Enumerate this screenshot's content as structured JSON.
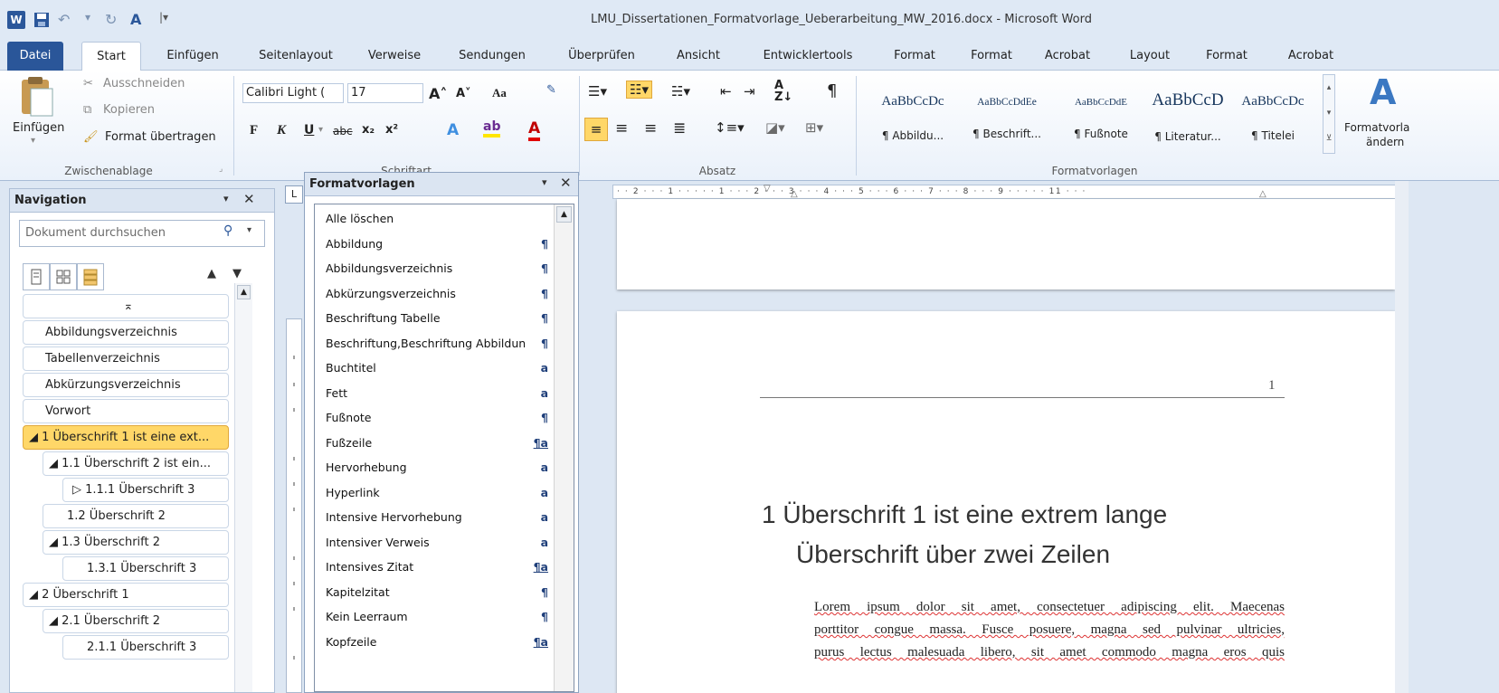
{
  "window": {
    "title": "LMU_Dissertationen_Formatvorlage_Ueberarbeitung_MW_2016.docx - Microsoft Word"
  },
  "tabs": [
    "Datei",
    "Start",
    "Einfügen",
    "Seitenlayout",
    "Verweise",
    "Sendungen",
    "Überprüfen",
    "Ansicht",
    "Entwicklertools",
    "Format",
    "Format",
    "Acrobat",
    "Layout",
    "Format",
    "Acrobat"
  ],
  "clipboard": {
    "paste_label": "Einfügen",
    "cut_label": "Ausschneiden",
    "copy_label": "Kopieren",
    "format_painter_label": "Format übertragen",
    "group_label": "Zwischenablage"
  },
  "font": {
    "name": "Calibri Light (",
    "size": "17",
    "bold": "F",
    "italic": "K",
    "underline": "U",
    "strikethrough": "abc",
    "subscript": "x₂",
    "superscript": "x²",
    "case": "Aa",
    "group_label": "Schriftart"
  },
  "paragraph": {
    "group_label": "Absatz",
    "pilcrow": "¶"
  },
  "styles_gallery": {
    "group_label": "Formatvorlagen",
    "change_label_line1": "Formatvorla",
    "change_label_line2": "ändern",
    "items": [
      {
        "sample": "AaBbCcDc",
        "name": "¶ Abbildu..."
      },
      {
        "sample": "AaBbCcDdEe",
        "name": "¶ Beschrift..."
      },
      {
        "sample": "AaBbCcDdE",
        "name": "¶ Fußnote"
      },
      {
        "sample": "AaBbCcD",
        "name": "¶ Literatur..."
      },
      {
        "sample": "AaBbCcDc",
        "name": "¶ Titelei"
      }
    ]
  },
  "navigation": {
    "title": "Navigation",
    "search_placeholder": "Dokument durchsuchen",
    "items": [
      {
        "label": "⌅",
        "level": 0
      },
      {
        "label": "Abbildungsverzeichnis",
        "level": 0
      },
      {
        "label": "Tabellenverzeichnis",
        "level": 0
      },
      {
        "label": "Abkürzungsverzeichnis",
        "level": 0
      },
      {
        "label": "Vorwort",
        "level": 0
      },
      {
        "label": "◢ 1 Überschrift 1 ist eine ext...",
        "level": 0
      },
      {
        "label": "◢ 1.1 Überschrift 2 ist ein...",
        "level": 1
      },
      {
        "label": "▷ 1.1.1 Überschrift 3",
        "level": 2
      },
      {
        "label": "1.2 Überschrift 2",
        "level": 1
      },
      {
        "label": "◢ 1.3 Überschrift 2",
        "level": 1
      },
      {
        "label": "1.3.1 Überschrift 3",
        "level": 2
      },
      {
        "label": "◢ 2 Überschrift 1",
        "level": 0
      },
      {
        "label": "◢ 2.1 Überschrift 2",
        "level": 1
      },
      {
        "label": "2.1.1 Überschrift 3",
        "level": 2
      }
    ],
    "selected_index": 5
  },
  "styles_pane": {
    "title": "Formatvorlagen",
    "items": [
      {
        "name": "Alle löschen",
        "mark": ""
      },
      {
        "name": "Abbildung",
        "mark": "¶"
      },
      {
        "name": "Abbildungsverzeichnis",
        "mark": "¶"
      },
      {
        "name": "Abkürzungsverzeichnis",
        "mark": "¶"
      },
      {
        "name": "Beschriftung Tabelle",
        "mark": "¶"
      },
      {
        "name": "Beschriftung,Beschriftung Abbildung",
        "mark": "¶"
      },
      {
        "name": "Buchtitel",
        "mark": "a"
      },
      {
        "name": "Fett",
        "mark": "a"
      },
      {
        "name": "Fußnote",
        "mark": "¶"
      },
      {
        "name": "Fußzeile",
        "mark": "¶a"
      },
      {
        "name": "Hervorhebung",
        "mark": "a"
      },
      {
        "name": "Hyperlink",
        "mark": "a"
      },
      {
        "name": "Intensive Hervorhebung",
        "mark": "a"
      },
      {
        "name": "Intensiver Verweis",
        "mark": "a"
      },
      {
        "name": "Intensives Zitat",
        "mark": "¶a"
      },
      {
        "name": "Kapitelzitat",
        "mark": "¶"
      },
      {
        "name": "Kein Leerraum",
        "mark": "¶"
      },
      {
        "name": "Kopfzeile",
        "mark": "¶a"
      }
    ]
  },
  "ruler": {
    "ticks": "· · 2 · · · 1 · · ·  · · 1 · · · 2 · · · 3 · · · 4 · · · 5 · · · 6 · · · 7 · · · 8 · · · 9 · · · · · 11 · · ·"
  },
  "document": {
    "page_number": "1",
    "heading_line1": "1  Überschrift 1 ist eine extrem lange",
    "heading_line2": "Überschrift über zwei Zeilen",
    "body_line1": "Lorem ipsum dolor sit amet, consectetuer adipiscing elit. Maecenas",
    "body_line2": "porttitor congue massa. Fusce posuere, magna sed pulvinar ultricies,",
    "body_line3": "purus lectus malesuada libero, sit amet commodo magna eros quis"
  },
  "colors": {
    "accent_blue": "#2a5699",
    "selection_yellow": "#ffd768",
    "ribbon_bg": "#dfe9f5"
  }
}
